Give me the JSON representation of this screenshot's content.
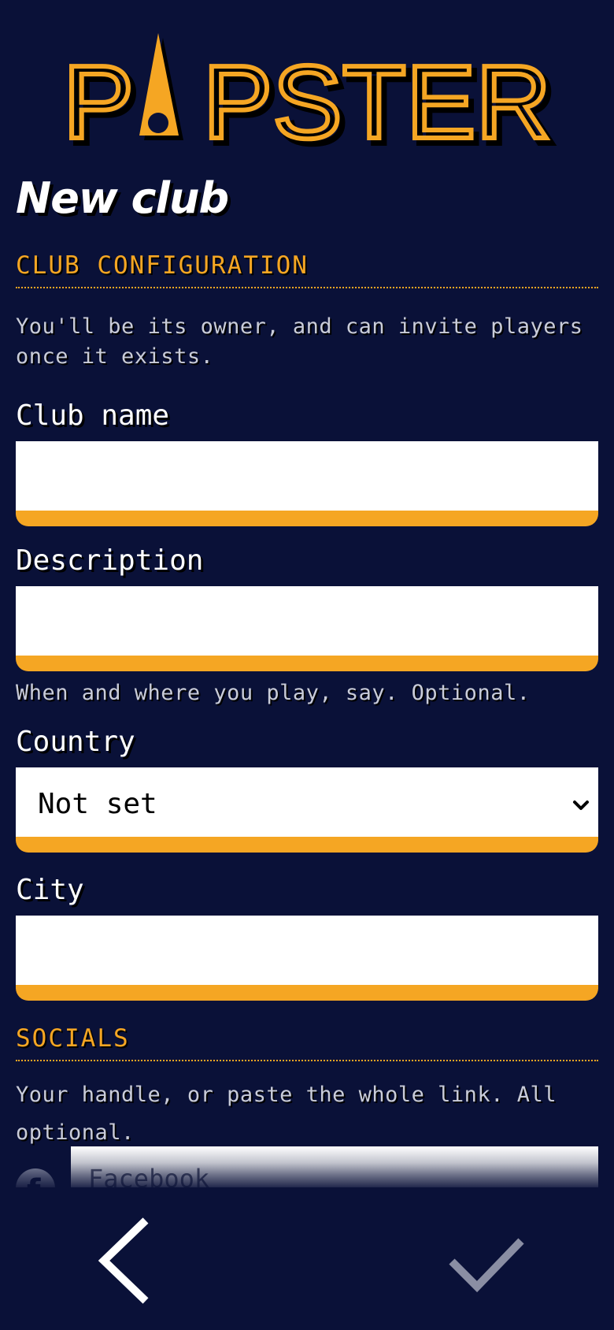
{
  "app": {
    "logo_text": "PAPSTER"
  },
  "page": {
    "title": "New club"
  },
  "club_config": {
    "heading": "CLUB CONFIGURATION",
    "help": "You'll be its owner, and can invite players once it exists."
  },
  "fields": {
    "club_name": {
      "label": "Club name",
      "value": ""
    },
    "description": {
      "label": "Description",
      "value": "",
      "help": "When and where you play, say. Optional."
    },
    "country": {
      "label": "Country",
      "selected": "Not set"
    },
    "city": {
      "label": "City",
      "value": ""
    }
  },
  "socials": {
    "heading": "SOCIALS",
    "help": "Your handle, or paste the whole link. All optional.",
    "facebook": {
      "placeholder": "Facebook",
      "icon": "facebook-icon"
    }
  },
  "bottom_nav": {
    "back_icon": "chevron-left-icon",
    "confirm_icon": "checkmark-icon"
  },
  "colors": {
    "background": "#0a1138",
    "accent": "#f5a623",
    "text": "#ffffff",
    "muted": "#c9ccd9"
  }
}
